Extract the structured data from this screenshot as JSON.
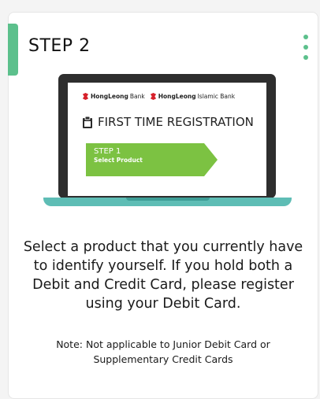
{
  "step": {
    "title": "STEP 2"
  },
  "illustration": {
    "logo_1_bold": "HongLeong",
    "logo_1_rest": "Bank",
    "logo_2_bold": "HongLeong",
    "logo_2_rest": "Islamic Bank",
    "registration_title": "FIRST TIME REGISTRATION",
    "progress_step_label": "STEP 1",
    "progress_step_sub": "Select Product"
  },
  "description": "Select a product that you currently have to identify yourself. If you hold both a Debit and Credit Card, please register using your Debit Card.",
  "note": "Note: Not applicable to Junior Debit Card or Supplementary Credit Cards",
  "colors": {
    "accent": "#5cc08c",
    "laptop_base": "#5ebdb5",
    "step_chevron": "#7cc242",
    "logo_red": "#d6202a"
  },
  "icons": {
    "menu": "vertical-dots-icon",
    "clipboard": "clipboard-icon",
    "logo": "hong-leong-logo"
  }
}
